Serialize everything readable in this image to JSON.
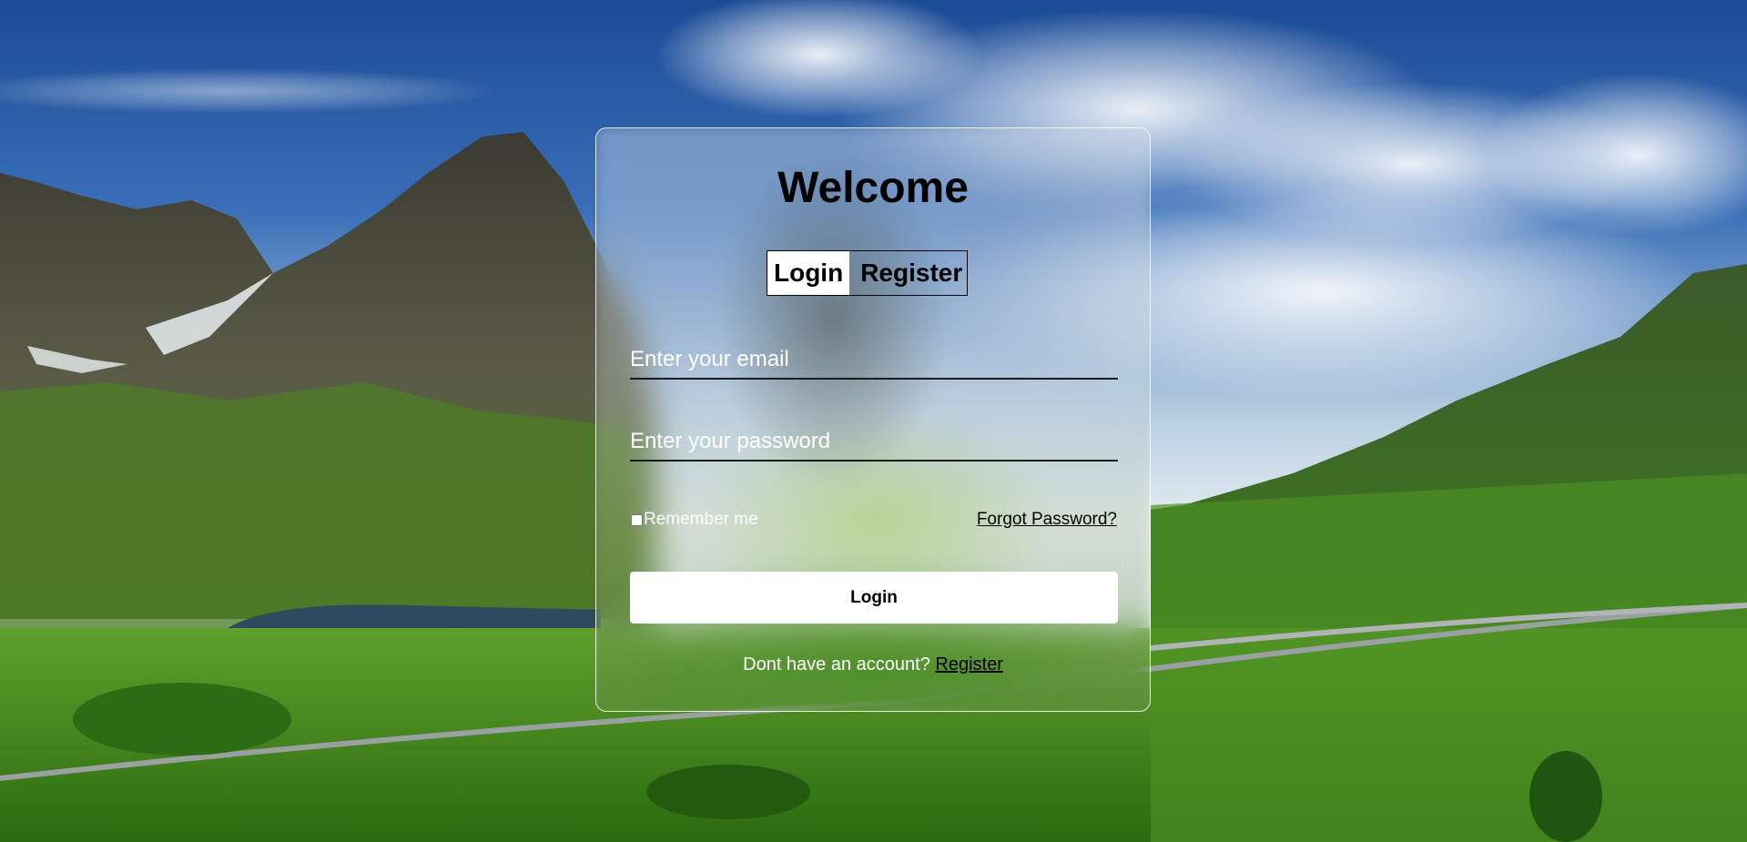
{
  "background": {
    "description_colors": {
      "sky_top": "#1d4f9c",
      "sky_mid": "#9fbfe0",
      "grass": "#3f8a1d",
      "mountain": "#4a4a3a"
    }
  },
  "card": {
    "title": "Welcome",
    "tabs": [
      {
        "label": "Login",
        "active": true
      },
      {
        "label": "Register",
        "active": false
      }
    ],
    "email_placeholder": "Enter your email",
    "password_placeholder": "Enter your password",
    "remember_label": "Remember me",
    "remember_checked": false,
    "forgot_label": "Forgot Password?",
    "login_button_label": "Login",
    "footer_text": "Dont have an account?",
    "footer_link": "Register"
  }
}
